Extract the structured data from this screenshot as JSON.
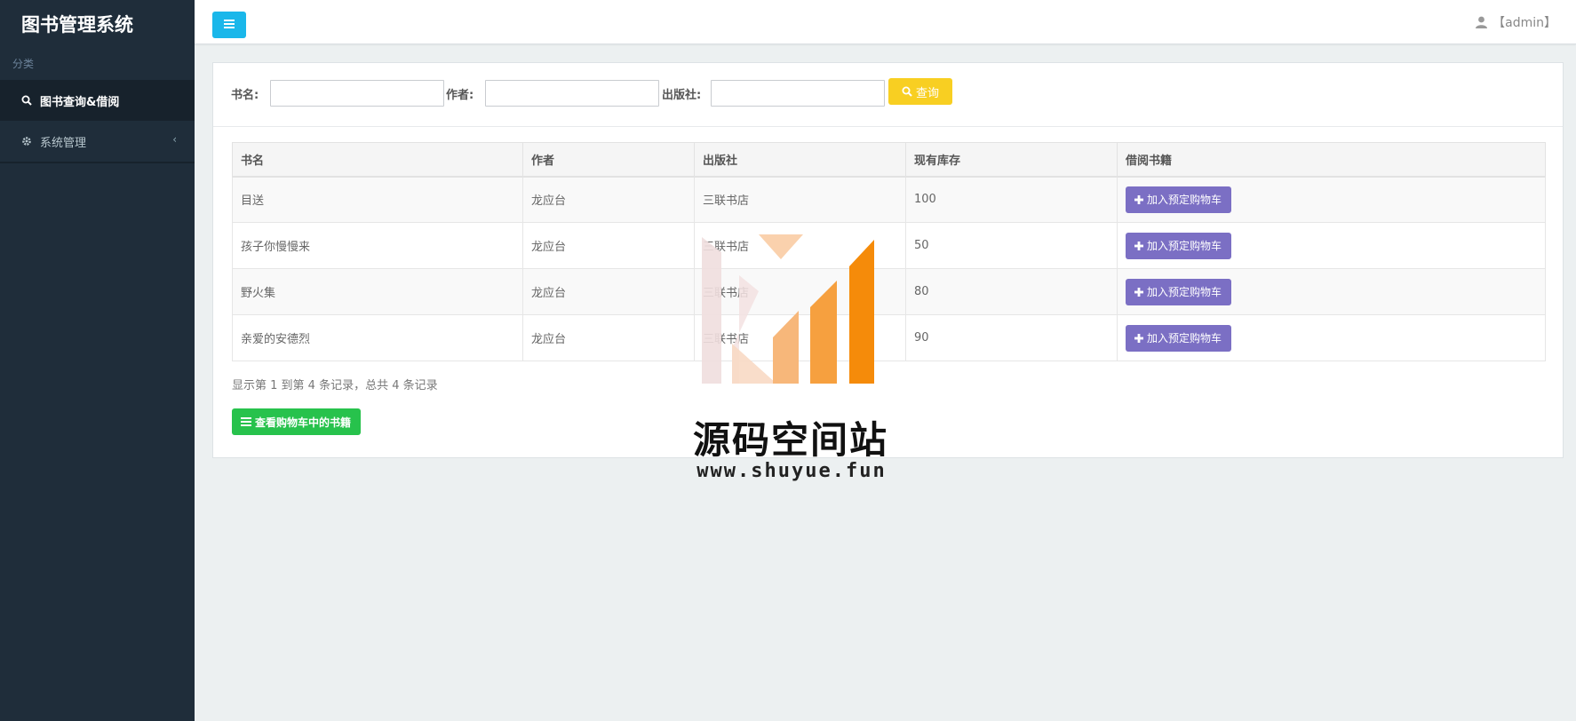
{
  "app": {
    "title": "图书管理系统",
    "section_label": "分类"
  },
  "sidebar": {
    "items": [
      {
        "label": "图书查询&借阅",
        "icon": "search-icon",
        "active": true
      },
      {
        "label": "系统管理",
        "icon": "gear-icon",
        "active": false
      }
    ]
  },
  "topbar": {
    "user": "【admin】"
  },
  "search": {
    "book_label": "书名:",
    "author_label": "作者:",
    "publisher_label": "出版社:",
    "book_value": "",
    "author_value": "",
    "publisher_value": "",
    "button_label": "查询"
  },
  "table": {
    "headers": [
      "书名",
      "作者",
      "出版社",
      "现有库存",
      "借阅书籍"
    ],
    "rows": [
      {
        "title": "目送",
        "author": "龙应台",
        "publisher": "三联书店",
        "stock": "100",
        "action": "加入预定购物车"
      },
      {
        "title": "孩子你慢慢来",
        "author": "龙应台",
        "publisher": "三联书店",
        "stock": "50",
        "action": "加入预定购物车"
      },
      {
        "title": "野火集",
        "author": "龙应台",
        "publisher": "三联书店",
        "stock": "80",
        "action": "加入预定购物车"
      },
      {
        "title": "亲爱的安德烈",
        "author": "龙应台",
        "publisher": "三联书店",
        "stock": "90",
        "action": "加入预定购物车"
      }
    ]
  },
  "footer": {
    "summary": "显示第 1 到第 4 条记录，总共 4 条记录",
    "cart_button": "查看购物车中的书籍"
  },
  "watermark": {
    "title": "源码空间站",
    "url": "www.shuyue.fun"
  },
  "colors": {
    "sidebar_bg": "#1f2d3a",
    "toggle_blue": "#1ab7ea",
    "query_yellow": "#f8cf22",
    "add_purple": "#7b6fc4",
    "cart_green": "#27c24c"
  }
}
